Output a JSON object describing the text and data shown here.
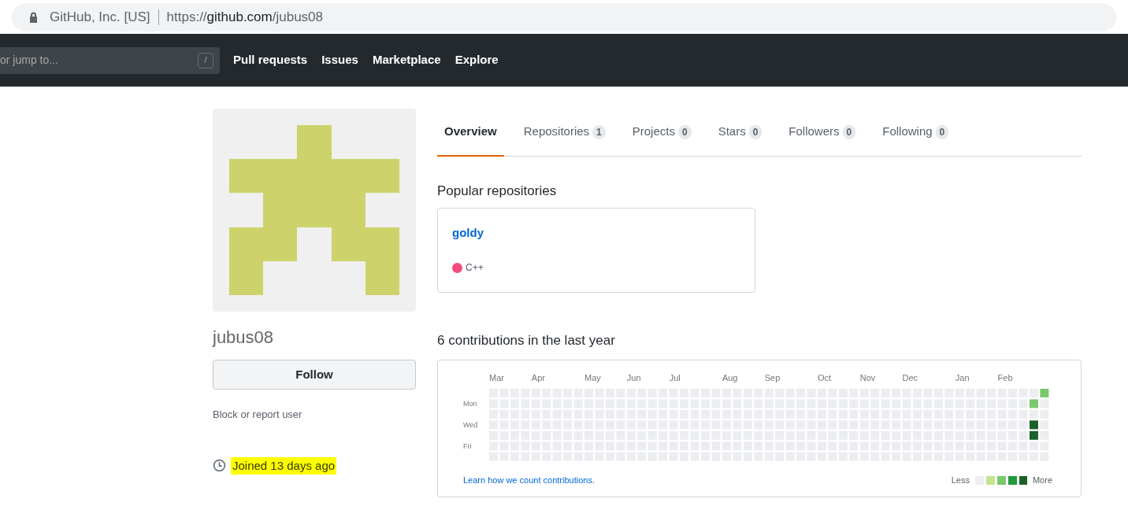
{
  "browser": {
    "site_identity": "GitHub, Inc. [US]",
    "url_prefix": "https://",
    "url_host": "github.com",
    "url_path": "/jubus08"
  },
  "header": {
    "search": {
      "placeholder": "or jump to...",
      "shortcut": "/"
    },
    "nav": [
      "Pull requests",
      "Issues",
      "Marketplace",
      "Explore"
    ]
  },
  "profile": {
    "avatar": {
      "kind": "identicon",
      "color": "#cdd36a"
    },
    "username": "jubus08",
    "follow_button": "Follow",
    "block_link": "Block or report user",
    "joined": "Joined 13 days ago",
    "joined_highlighted": true
  },
  "tabs": [
    {
      "label": "Overview",
      "selected": true
    },
    {
      "label": "Repositories",
      "count": "1",
      "selected": false
    },
    {
      "label": "Projects",
      "count": "0",
      "selected": false
    },
    {
      "label": "Stars",
      "count": "0",
      "selected": false
    },
    {
      "label": "Followers",
      "count": "0",
      "selected": false
    },
    {
      "label": "Following",
      "count": "0",
      "selected": false
    }
  ],
  "popular": {
    "title": "Popular repositories",
    "repos": [
      {
        "name": "goldy",
        "language": "C++",
        "color": "#f34b7d"
      }
    ]
  },
  "contributions": {
    "title": "6 contributions in the last year",
    "months": [
      "Mar",
      "Apr",
      "May",
      "Jun",
      "Jul",
      "Aug",
      "Sep",
      "Oct",
      "Nov",
      "Dec",
      "Jan",
      "Feb"
    ],
    "day_labels": [
      "Mon",
      "Wed",
      "Fri"
    ],
    "learn_link": "Learn how we count contributions.",
    "legend": {
      "less": "Less",
      "more": "More"
    }
  }
}
